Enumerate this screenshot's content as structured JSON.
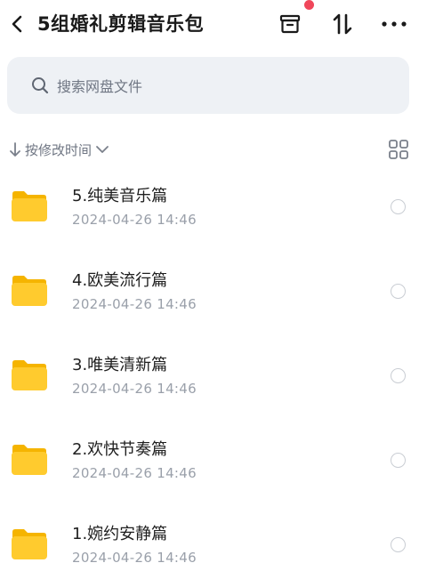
{
  "header": {
    "title": "5组婚礼剪辑音乐包",
    "back_icon": "chevron-left-icon",
    "actions": [
      "archive-icon",
      "sort-icon",
      "more-icon"
    ],
    "notification_color": "#f0465a"
  },
  "search": {
    "placeholder": "搜索网盘文件",
    "icon": "search-icon"
  },
  "sort": {
    "label": "按修改时间",
    "icon": "arrow-down-icon",
    "dropdown_icon": "chevron-down-icon",
    "view_icon": "grid-view-icon"
  },
  "items": [
    {
      "name": "5.纯美音乐篇",
      "date": "2024-04-26  14:46",
      "icon": "folder-icon"
    },
    {
      "name": "4.欧美流行篇",
      "date": "2024-04-26  14:46",
      "icon": "folder-icon"
    },
    {
      "name": "3.唯美清新篇",
      "date": "2024-04-26  14:46",
      "icon": "folder-icon"
    },
    {
      "name": "2.欢快节奏篇",
      "date": "2024-04-26  14:46",
      "icon": "folder-icon"
    },
    {
      "name": "1.婉约安静篇",
      "date": "2024-04-26  14:46",
      "icon": "folder-icon"
    }
  ],
  "colors": {
    "folder": "#ffcb2e",
    "folder_back": "#f5b400",
    "search_bg": "#eef1f5"
  }
}
